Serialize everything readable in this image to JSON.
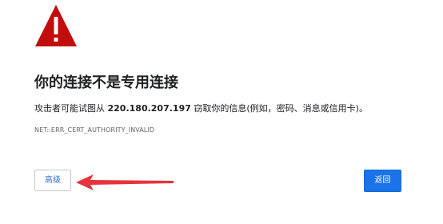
{
  "icons": {
    "warning": "warning-triangle-icon",
    "annotation": "red-arrow-icon"
  },
  "colors": {
    "warning_red": "#c20d0d",
    "primary_blue": "#1a73e8",
    "annotation_red": "#e8323c"
  },
  "interstitial": {
    "title": "你的连接不是专用连接",
    "description_prefix": "攻击者可能试图从 ",
    "host": "220.180.207.197",
    "description_suffix": " 窃取你的信息(例如，密码、消息或信用卡)。",
    "error_code": "NET::ERR_CERT_AUTHORITY_INVALID"
  },
  "buttons": {
    "advanced": "高级",
    "back": "返回"
  }
}
